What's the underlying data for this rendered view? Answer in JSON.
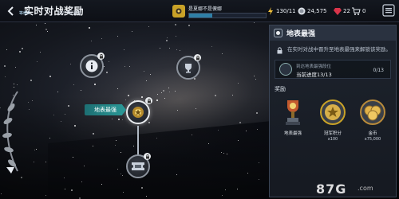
{
  "header": {
    "title": "实时对战奖励",
    "player_name": "是夏娜不是傻娜",
    "level_label": "等级2",
    "xp_text": "22/73经验值",
    "xp_progress": 0.3
  },
  "resources": {
    "energy": "130/11",
    "credits": "24,575",
    "gems": "22",
    "cart_count": "0"
  },
  "map": {
    "selected_node_label": "地表最强"
  },
  "panel": {
    "title": "地表最强",
    "description": "在实时对战中晋升至地表最强来解锁该奖励。",
    "progress_label": "到达地表最强段位",
    "progress_current": "当前进度13/13",
    "progress_count": "0/13",
    "rewards_heading": "奖励",
    "rewards": [
      {
        "label": "地表最强",
        "amount": ""
      },
      {
        "label": "冠军积分",
        "amount": "x100"
      },
      {
        "label": "金币",
        "amount": "x75,000"
      }
    ]
  },
  "watermark": {
    "text": "87G",
    "sub": ".com"
  }
}
